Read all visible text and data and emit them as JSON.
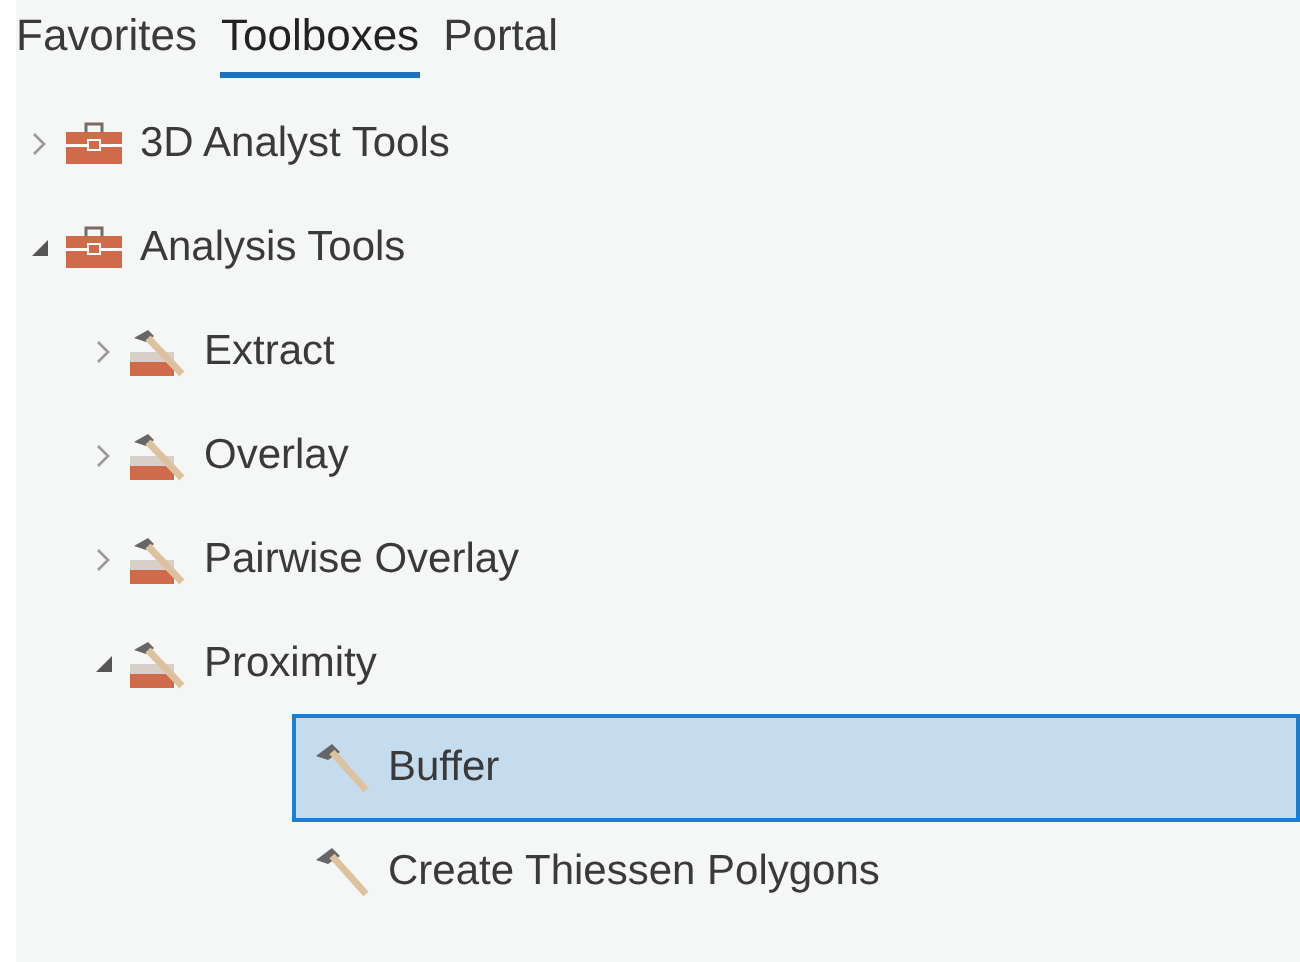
{
  "tabs": [
    {
      "label": "Favorites",
      "selected": false
    },
    {
      "label": "Toolboxes",
      "selected": true
    },
    {
      "label": "Portal",
      "selected": false
    }
  ],
  "tree": [
    {
      "kind": "toolbox",
      "label": "3D Analyst Tools",
      "expanded": false
    },
    {
      "kind": "toolbox",
      "label": "Analysis Tools",
      "expanded": true,
      "children": [
        {
          "kind": "toolset",
          "label": "Extract",
          "expanded": false
        },
        {
          "kind": "toolset",
          "label": "Overlay",
          "expanded": false
        },
        {
          "kind": "toolset",
          "label": "Pairwise Overlay",
          "expanded": false
        },
        {
          "kind": "toolset",
          "label": "Proximity",
          "expanded": true,
          "children": [
            {
              "kind": "tool",
              "label": "Buffer",
              "selected": true
            },
            {
              "kind": "tool",
              "label": "Create Thiessen Polygons",
              "selected": false
            }
          ]
        }
      ]
    }
  ]
}
